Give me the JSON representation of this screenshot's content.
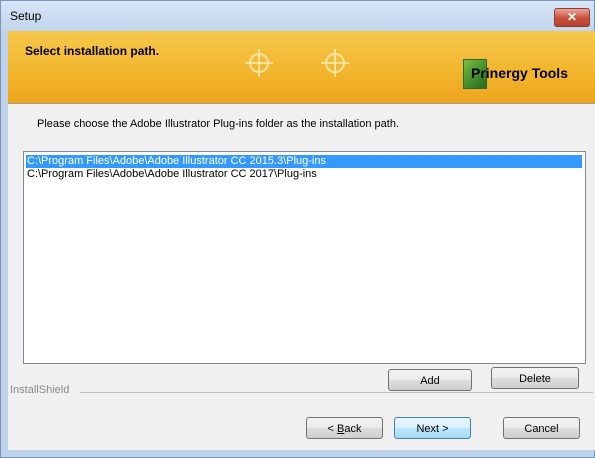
{
  "window": {
    "title": "Setup",
    "close_label": "✕"
  },
  "banner": {
    "title": "Select installation path.",
    "logo_text": "Prinergy Tools"
  },
  "instruction": "Please choose the Adobe Illustrator Plug-ins folder as the installation path.",
  "paths": [
    {
      "label": "C:\\Program Files\\Adobe\\Adobe Illustrator CC 2015.3\\Plug-ins",
      "selected": true
    },
    {
      "label": "C:\\Program Files\\Adobe\\Adobe Illustrator CC 2017\\Plug-ins",
      "selected": false
    }
  ],
  "buttons": {
    "add": "Add",
    "delete": "Delete",
    "back_prefix": "< ",
    "back_mnemonic": "B",
    "back_rest": "ack",
    "next": "Next >",
    "cancel": "Cancel"
  },
  "footer": {
    "brand": "InstallShield"
  },
  "colors": {
    "selection": "#3399ff",
    "banner": "#f2b42c",
    "close": "#c94f3a"
  }
}
